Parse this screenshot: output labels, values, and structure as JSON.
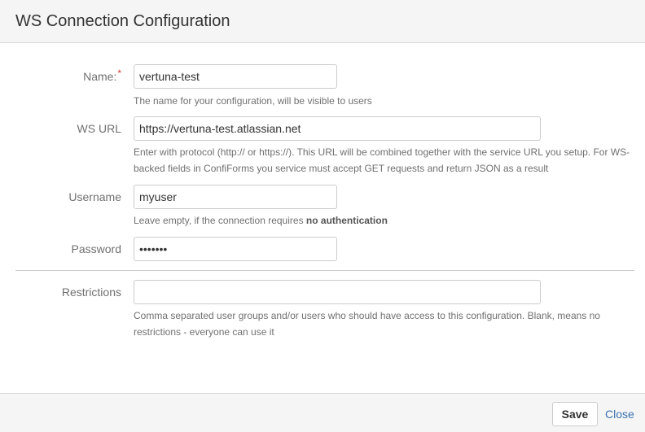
{
  "dialog": {
    "title": "WS Connection Configuration"
  },
  "form": {
    "name": {
      "label": "Name:",
      "required_marker": "*",
      "value": "vertuna-test",
      "help": "The name for your configuration, will be visible to users"
    },
    "ws_url": {
      "label": "WS URL",
      "value": "https://vertuna-test.atlassian.net",
      "help_line1": "Enter with protocol (http:// or https://). This URL will be combined together with the service URL you setup. For WS-",
      "help_line2": "backed fields in ConfiForms you service must accept GET requests and return JSON as a result"
    },
    "username": {
      "label": "Username",
      "value": "myuser",
      "help_prefix": "Leave empty, if the connection requires ",
      "help_bold": "no authentication"
    },
    "password": {
      "label": "Password",
      "value": "•••••••"
    },
    "restrictions": {
      "label": "Restrictions",
      "value": "",
      "help_line1": "Comma separated user groups and/or users who should have access to this configuration. Blank, means no",
      "help_line2": "restrictions - everyone can use it"
    }
  },
  "footer": {
    "save_label": "Save",
    "close_label": "Close"
  },
  "colors": {
    "header_bg": "#f5f5f5",
    "required": "#d04437",
    "link": "#3b73af"
  }
}
